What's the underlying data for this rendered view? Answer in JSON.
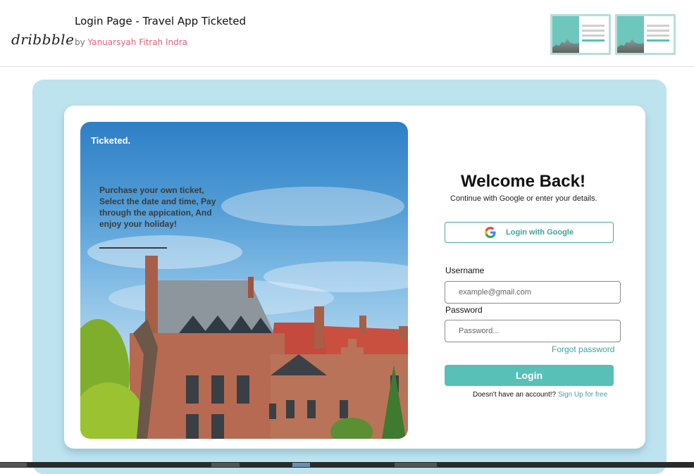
{
  "header": {
    "logo": "dribbble",
    "title": "Login Page - Travel App Ticketed",
    "by": "by",
    "author": "Yanuarsyah Fitrah Indra"
  },
  "hero": {
    "brand": "Ticketed.",
    "tagline": "Purchase your own ticket, Select the date and time, Pay through the appication, And enjoy your holiday!"
  },
  "form": {
    "title": "Welcome Back!",
    "subtitle": "Continue with Google or enter your details.",
    "google_label": "Login with Google",
    "username_label": "Username",
    "username_placeholder": "example@gmail.com",
    "password_label": "Password",
    "password_placeholder": "Password...",
    "forgot": "Forgot password",
    "login": "Login",
    "no_account": "Doesn't have an account!?",
    "signup": "Sign Up for free"
  },
  "colors": {
    "accent": "#58c0b7",
    "accent_text": "#3fa39c",
    "stage_bg": "#bde3ef",
    "author": "#e0627d"
  }
}
